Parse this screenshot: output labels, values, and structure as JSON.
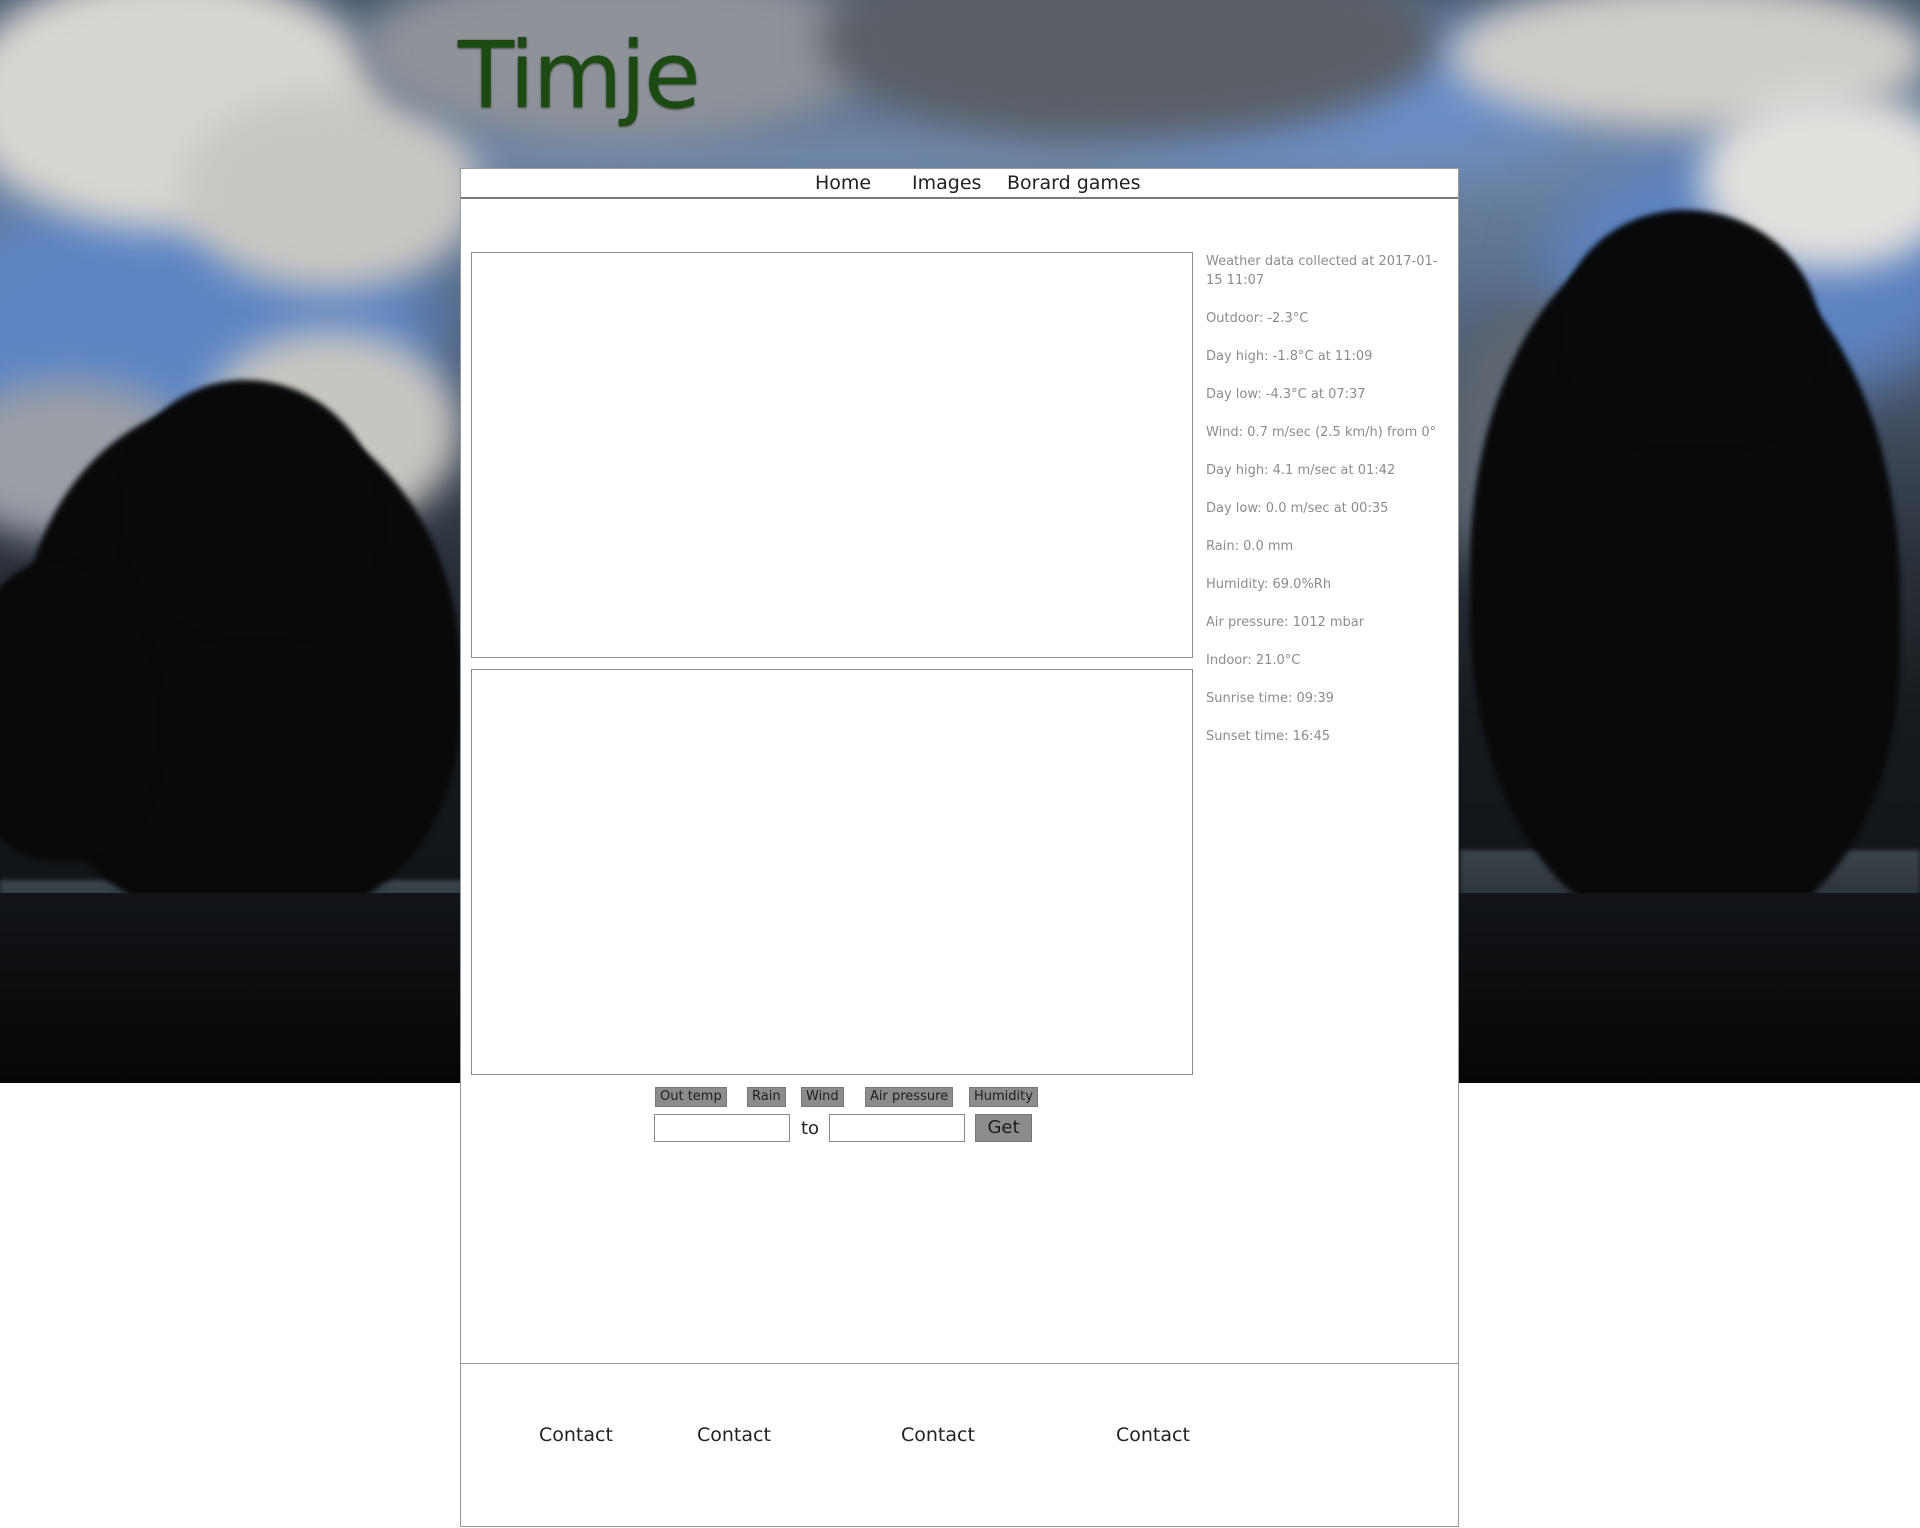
{
  "site": {
    "title": "Timje"
  },
  "nav": {
    "items": [
      {
        "label": "Home"
      },
      {
        "label": "Images"
      },
      {
        "label": "Borard games"
      }
    ]
  },
  "weather": {
    "collected": "Weather data collected at 2017-01-15 11:07",
    "outdoor": "Outdoor: -2.3°C",
    "day_high_temp": "Day high: -1.8°C at 11:09",
    "day_low_temp": "Day low: -4.3°C at 07:37",
    "wind": "Wind: 0.7 m/sec (2.5 km/h) from 0°",
    "day_high_wind": "Day high: 4.1 m/sec at 01:42",
    "day_low_wind": "Day low: 0.0 m/sec at 00:35",
    "rain": "Rain: 0.0 mm",
    "humidity": "Humidity: 69.0%Rh",
    "air_pressure": "Air pressure: 1012 mbar",
    "indoor": "Indoor: 21.0°C",
    "sunrise": "Sunrise time: 09:39",
    "sunset": "Sunset time: 16:45"
  },
  "controls": {
    "series_buttons": [
      {
        "label": "Out temp"
      },
      {
        "label": "Rain"
      },
      {
        "label": "Wind"
      },
      {
        "label": "Air pressure"
      },
      {
        "label": "Humidity"
      }
    ],
    "from_value": "",
    "to_label": "to",
    "to_value": "",
    "get_label": "Get"
  },
  "footer": {
    "links": [
      {
        "label": "Contact"
      },
      {
        "label": "Contact"
      },
      {
        "label": "Contact"
      },
      {
        "label": "Contact"
      }
    ]
  },
  "colors": {
    "title_green": "#1c4a12",
    "panel_bg": "#ffffff",
    "button_grey": "#8c8c8c",
    "weather_text": "#8c8c8c"
  }
}
